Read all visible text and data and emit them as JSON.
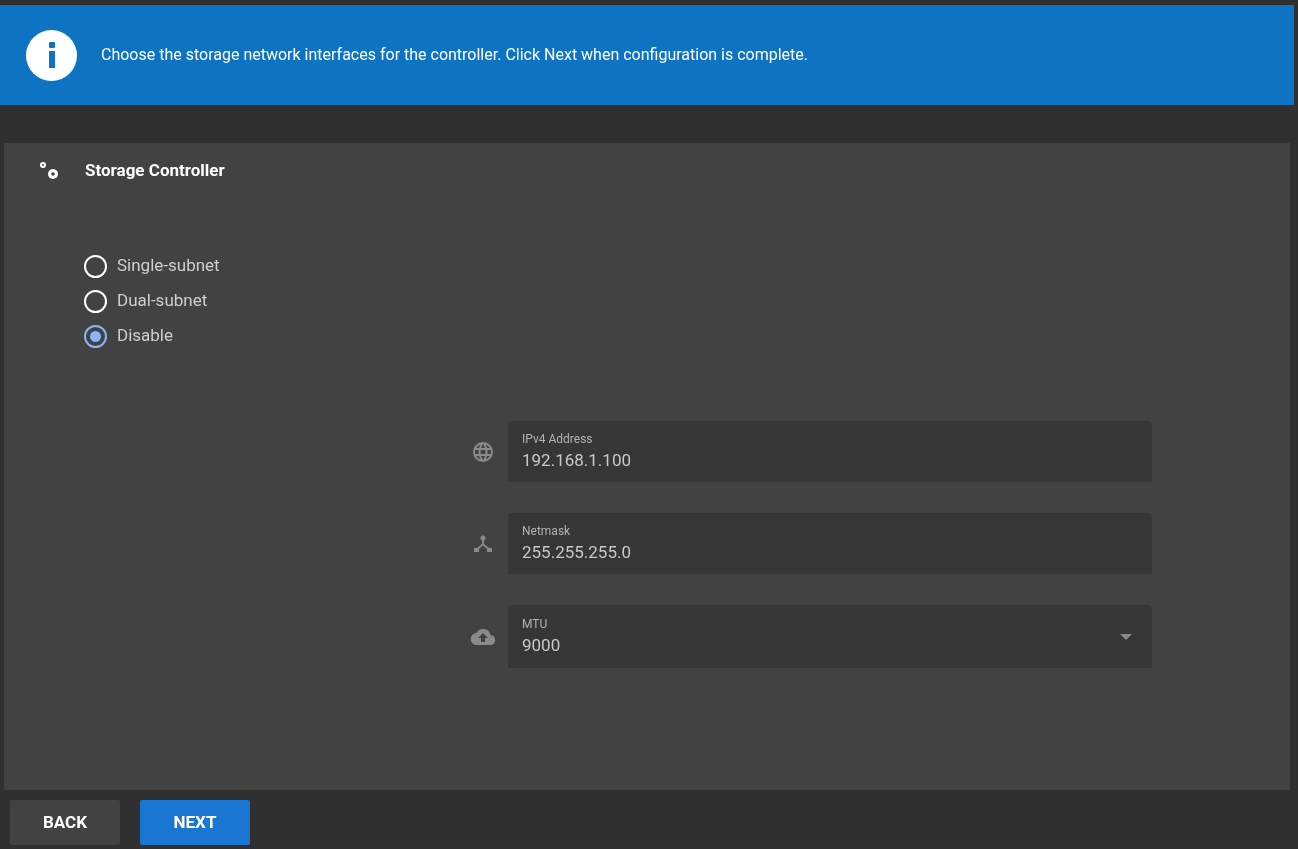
{
  "banner": {
    "message": "Choose the storage network interfaces for the controller. Click Next when configuration is complete."
  },
  "panel": {
    "title": "Storage Controller"
  },
  "options": [
    {
      "label": "Single-subnet",
      "selected": false
    },
    {
      "label": "Dual-subnet",
      "selected": false
    },
    {
      "label": "Disable",
      "selected": true
    }
  ],
  "fields": [
    {
      "kind": "text",
      "label": "IPv4 Address",
      "value": "192.168.1.100"
    },
    {
      "kind": "text",
      "label": "Netmask",
      "value": "255.255.255.0"
    },
    {
      "kind": "select",
      "label": "MTU",
      "value": "9000"
    }
  ],
  "buttons": [
    {
      "label": "BACK",
      "kind": "secondary"
    },
    {
      "label": "NEXT",
      "kind": "primary"
    }
  ]
}
